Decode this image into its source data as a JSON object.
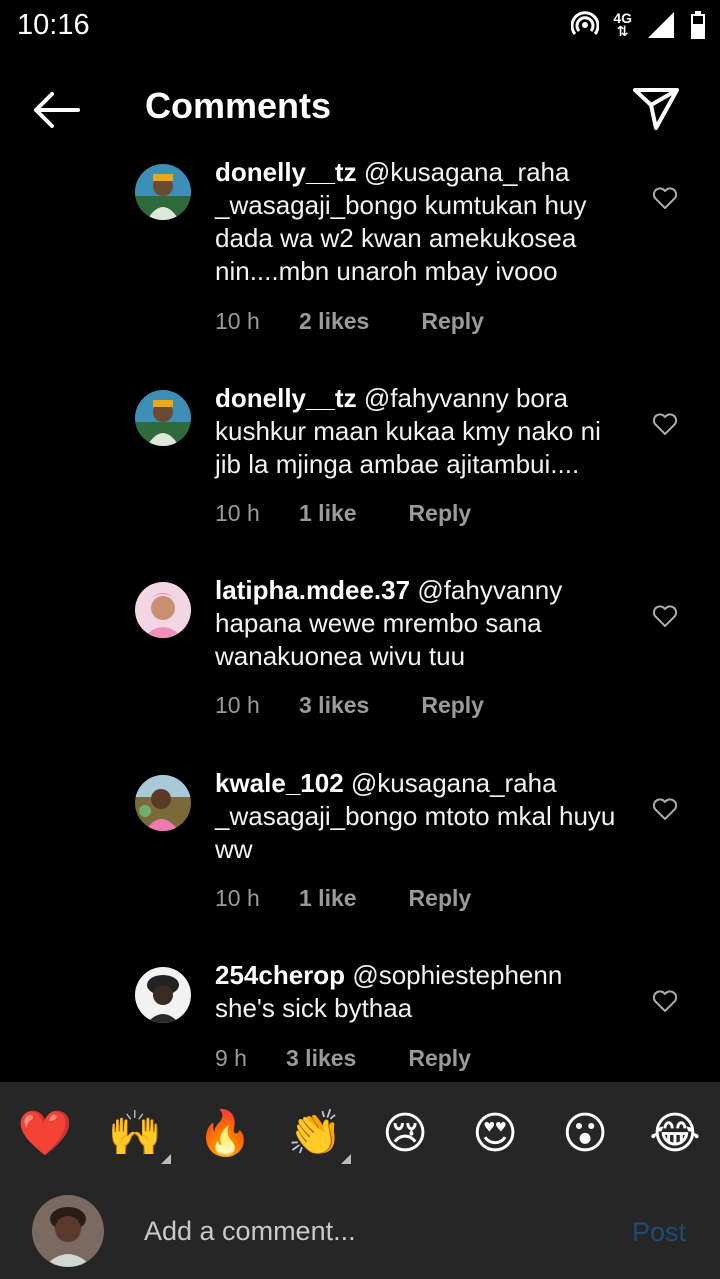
{
  "status": {
    "time": "10:16",
    "network": "4G"
  },
  "header": {
    "title": "Comments"
  },
  "comments": [
    {
      "user": "donelly__tz",
      "text": "@kusagana_raha _wasagaji_bongo kumtukan huy dada wa w2 kwan amekukosea nin....mbn unaroh mbay ivooo",
      "time": "10 h",
      "likes": "2 likes",
      "reply": "Reply"
    },
    {
      "user": "donelly__tz",
      "text": "@fahyvanny bora kushkur maan kukaa kmy nako ni jib la mjinga ambae ajitambui....",
      "time": "10 h",
      "likes": "1 like",
      "reply": "Reply"
    },
    {
      "user": "latipha.mdee.37",
      "text": "@fahyvanny hapana wewe mrembo sana wanakuonea wivu tuu",
      "time": "10 h",
      "likes": "3 likes",
      "reply": "Reply"
    },
    {
      "user": "kwale_102",
      "text": "@kusagana_raha _wasagaji_bongo mtoto mkal huyu ww",
      "time": "10 h",
      "likes": "1 like",
      "reply": "Reply"
    },
    {
      "user": "254cherop",
      "text": "@sophiestephenn she's sick bythaa",
      "time": "9 h",
      "likes": "3 likes",
      "reply": "Reply"
    }
  ],
  "emojis": [
    "❤️",
    "🙌",
    "🔥",
    "👏",
    "😢",
    "😍",
    "😮",
    "😂"
  ],
  "compose": {
    "placeholder": "Add a comment...",
    "post_label": "Post"
  },
  "colors": {
    "background": "#000000",
    "bar": "#262626",
    "post_disabled": "#1d4a78",
    "meta": "#9a9a9a"
  }
}
